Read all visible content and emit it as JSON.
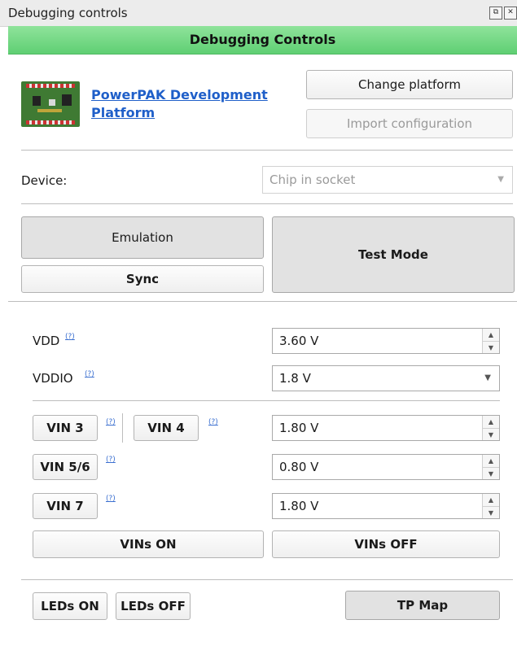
{
  "window": {
    "title": "Debugging controls"
  },
  "banner": {
    "title": "Debugging Controls"
  },
  "platform": {
    "link": "PowerPAK Development Platform",
    "change_button": "Change platform",
    "import_button": "Import configuration"
  },
  "device": {
    "label": "Device:",
    "value": "Chip in socket"
  },
  "modes": {
    "emulation": "Emulation",
    "test_mode": "Test Mode",
    "sync": "Sync"
  },
  "supplies": {
    "help_mark": "(?)",
    "vdd": {
      "label": "VDD",
      "value": "3.60 V"
    },
    "vddio": {
      "label": "VDDIO",
      "value": "1.8 V"
    }
  },
  "vins": {
    "vin3": "VIN 3",
    "vin4": "VIN 4",
    "vin34_value": "1.80 V",
    "vin56": "VIN 5/6",
    "vin56_value": "0.80 V",
    "vin7": "VIN 7",
    "vin7_value": "1.80 V",
    "on": "VINs ON",
    "off": "VINs OFF"
  },
  "footer": {
    "leds_on": "LEDs ON",
    "leds_off": "LEDs OFF",
    "tp_map": "TP Map"
  },
  "colors": {
    "banner_green": "#5fcf73",
    "link_blue": "#1f5fc9"
  }
}
